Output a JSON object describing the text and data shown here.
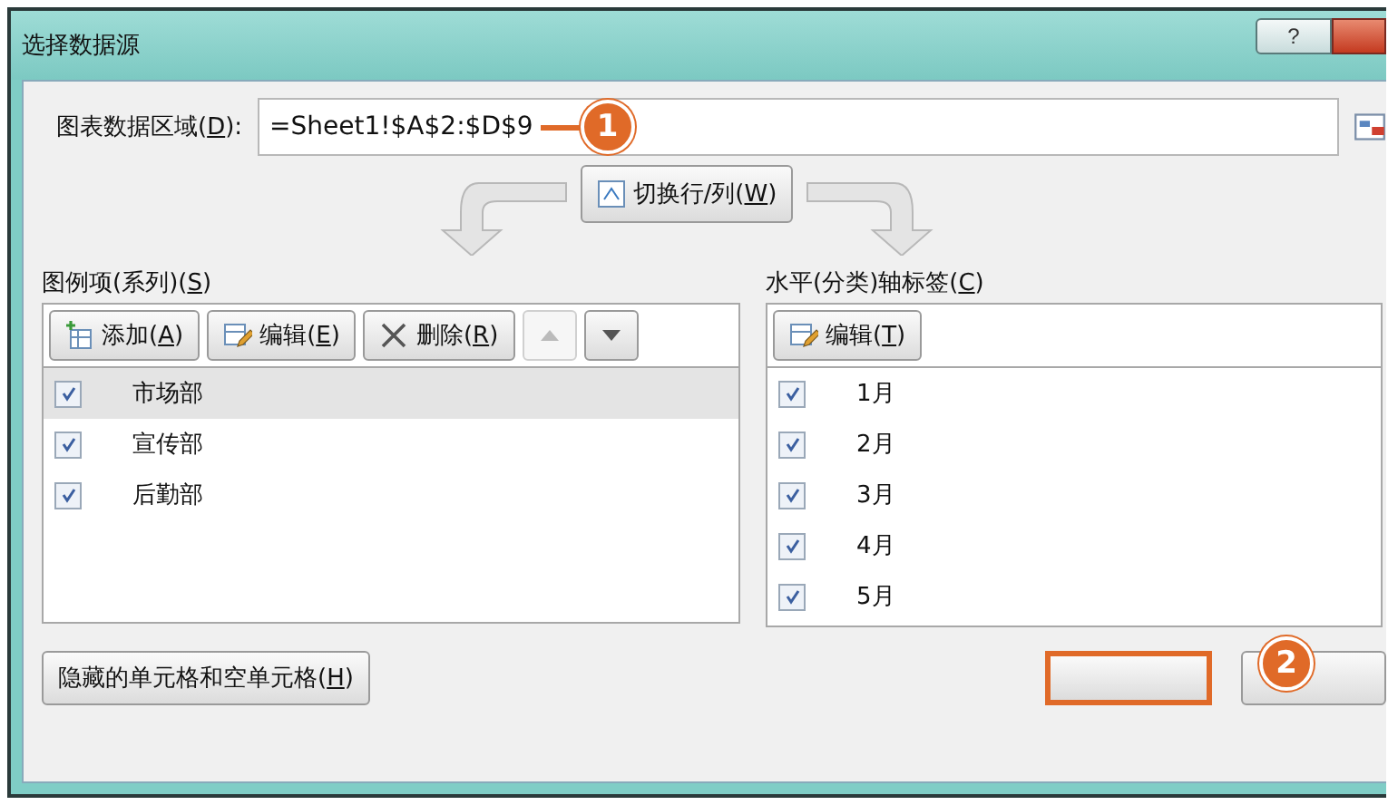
{
  "window": {
    "title": "选择数据源",
    "help": "?"
  },
  "range": {
    "label": {
      "pre": "图表数据区域(",
      "key": "D",
      "post": "):"
    },
    "value": "=Sheet1!$A$2:$D$9",
    "callout": "1"
  },
  "switch_button": {
    "pre": "切换行/列(",
    "key": "W",
    "post": ")"
  },
  "series_panel": {
    "label": {
      "pre": "图例项(系列)(",
      "key": "S",
      "post": ")"
    },
    "buttons": [
      {
        "kind": "add",
        "pre": "添加(",
        "key": "A",
        "post": ")"
      },
      {
        "kind": "edit",
        "pre": "编辑(",
        "key": "E",
        "post": ")"
      },
      {
        "kind": "delete",
        "pre": "删除(",
        "key": "R",
        "post": ")"
      },
      {
        "kind": "up",
        "disabled": true
      },
      {
        "kind": "down",
        "disabled": false
      }
    ],
    "items": [
      {
        "name": "市场部",
        "checked": true,
        "selected": true
      },
      {
        "name": "宣传部",
        "checked": true,
        "selected": false
      },
      {
        "name": "后勤部",
        "checked": true,
        "selected": false
      }
    ]
  },
  "axis_panel": {
    "label": {
      "pre": "水平(分类)轴标签(",
      "key": "C",
      "post": ")"
    },
    "buttons": [
      {
        "kind": "edit",
        "pre": "编辑(",
        "key": "T",
        "post": ")"
      }
    ],
    "items": [
      {
        "name": "1月",
        "checked": true
      },
      {
        "name": "2月",
        "checked": true
      },
      {
        "name": "3月",
        "checked": true
      },
      {
        "name": "4月",
        "checked": true
      },
      {
        "name": "5月",
        "checked": true
      }
    ]
  },
  "hidden_cells_button": {
    "pre": "隐藏的单元格和空单元格(",
    "key": "H",
    "post": ")"
  },
  "footer": {
    "ok_highlighted": true,
    "callout": "2"
  }
}
